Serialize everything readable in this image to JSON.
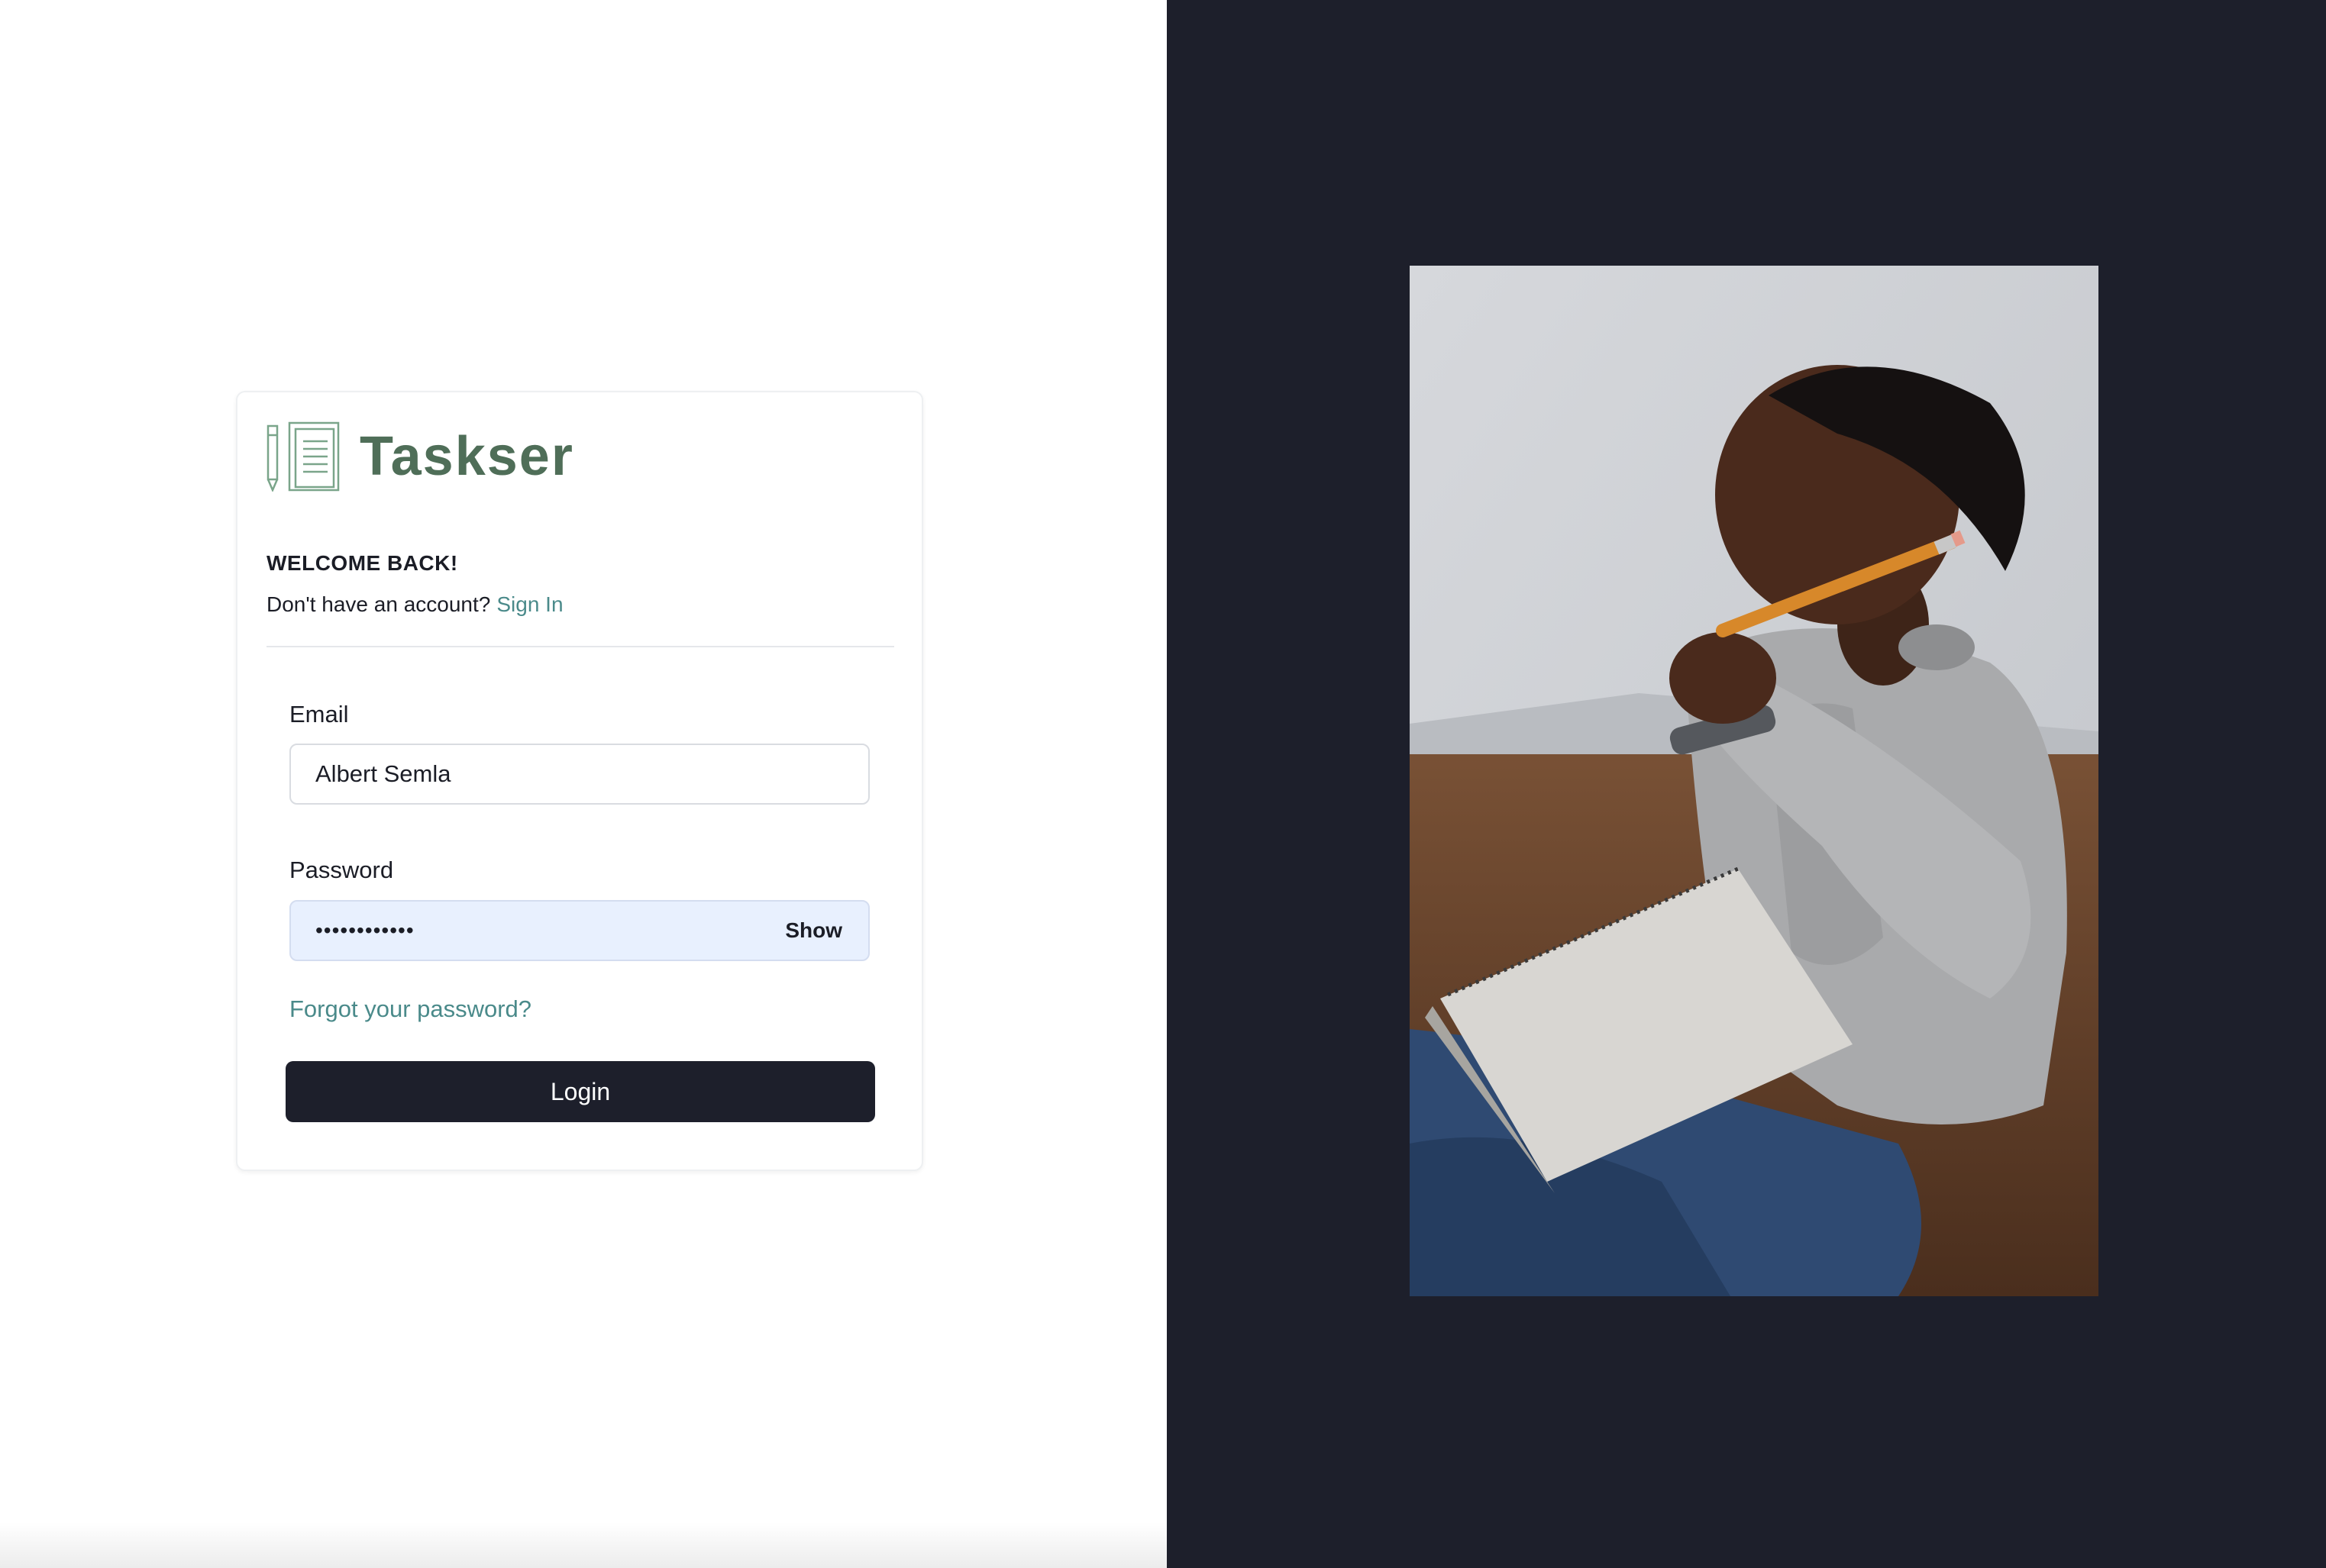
{
  "brand": {
    "name": "Taskser",
    "icon": "notepad-pencil-icon",
    "color": "#4f6e58"
  },
  "login": {
    "heading": "WELCOME BACK!",
    "no_account_text": "Don't have an account?",
    "sign_in_link": "Sign In",
    "email_label": "Email",
    "email_value": "Albert Semla",
    "password_label": "Password",
    "password_value": "••••••••••••",
    "show_label": "Show",
    "forgot_link": "Forgot your password?",
    "login_button": "Login"
  },
  "colors": {
    "accent_link": "#4a8a8a",
    "dark": "#1d1f2b",
    "autofill_bg": "#e8f0fe"
  },
  "hero_image": {
    "subject": "child-thinking-with-pencil-and-notebook"
  }
}
